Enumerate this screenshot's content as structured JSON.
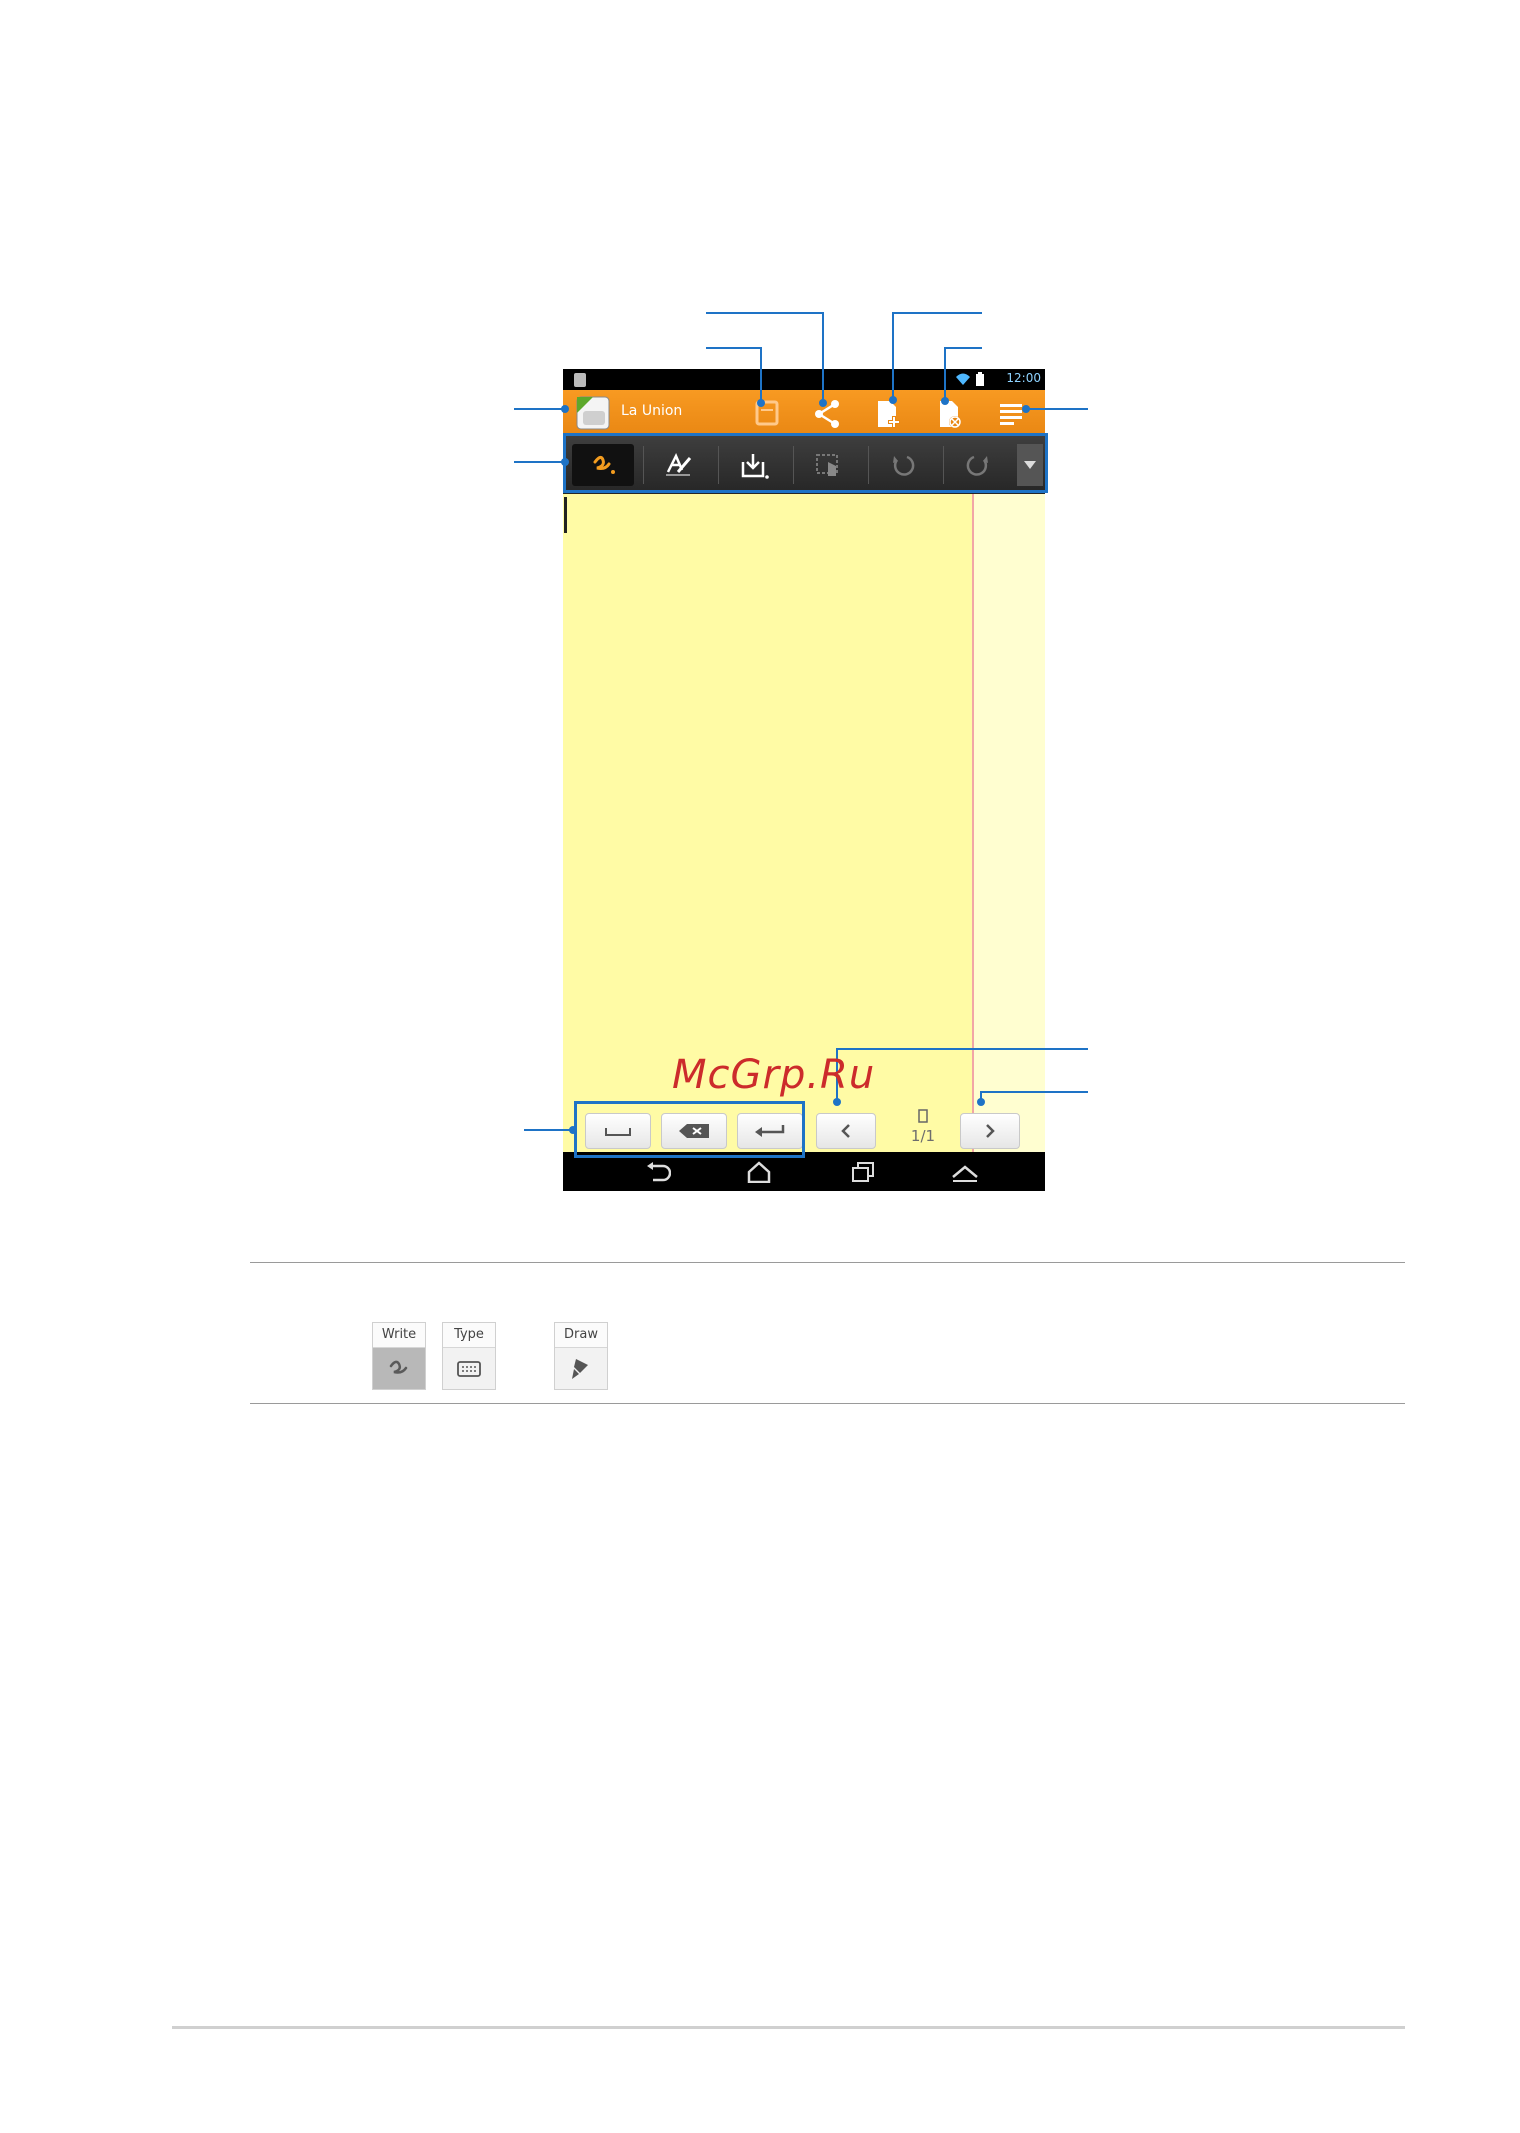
{
  "app": {
    "status_time": "12:00",
    "notebook_title": "La Union",
    "page_indicator": "1/1"
  },
  "watermark": "McGrp.Ru",
  "modes": [
    {
      "label": "Write",
      "icon": "pen-scribble-icon"
    },
    {
      "label": "Type",
      "icon": "keyboard-icon"
    },
    {
      "label": "Draw",
      "icon": "brush-icon"
    }
  ],
  "colors": {
    "accent_orange": "#f08e19",
    "callout_blue": "#1e73c6",
    "note_yellow": "#fffba5",
    "watermark_red": "#cc2b2b"
  }
}
